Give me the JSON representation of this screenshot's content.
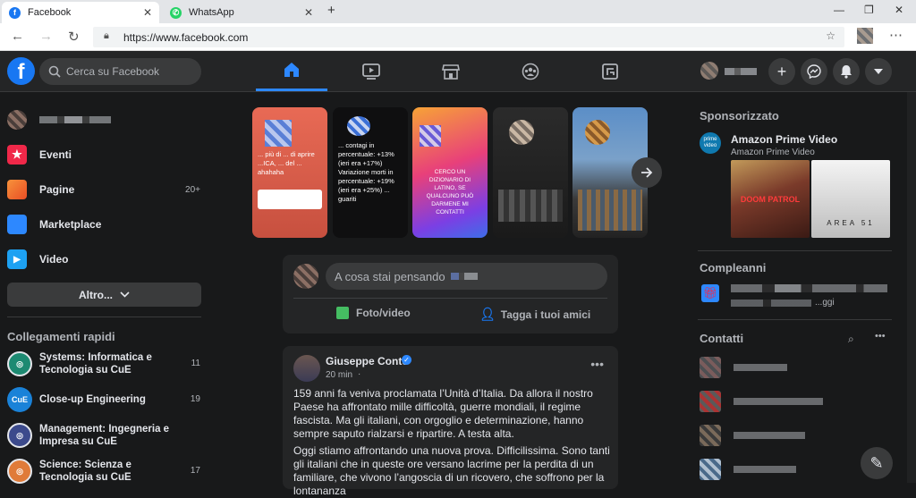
{
  "browser": {
    "tabs": [
      {
        "title": "Facebook",
        "active": true
      },
      {
        "title": "WhatsApp",
        "active": false
      }
    ],
    "url": "https://www.facebook.com"
  },
  "header": {
    "search_placeholder": "Cerca su Facebook",
    "accent": "#2d88ff"
  },
  "left_nav": {
    "items": [
      {
        "label": "Eventi",
        "badge": ""
      },
      {
        "label": "Pagine",
        "badge": "20+"
      },
      {
        "label": "Marketplace",
        "badge": ""
      },
      {
        "label": "Video",
        "badge": ""
      }
    ],
    "more_label": "Altro...",
    "shortcuts_title": "Collegamenti rapidi",
    "shortcuts": [
      {
        "label": "Systems: Informatica e Tecnologia su CuE",
        "badge": "11"
      },
      {
        "label": "Close-up Engineering",
        "badge": "19"
      },
      {
        "label": "Management: Ingegneria e Impresa su CuE",
        "badge": ""
      },
      {
        "label": "Science: Scienza e Tecnologia su CuE",
        "badge": "17"
      }
    ]
  },
  "stories": [
    {
      "text": "... più di ... di aprire ...ICA, ... del ... ahahaha"
    },
    {
      "text": "... contagi in percentuale: +13% (ieri era +17%) Variazione morti in percentuale: +19% (ieri era +25%) ... guariti"
    },
    {
      "text": "CERCO UN DIZIONARIO DI LATINO, SE QUALCUNO PUÒ DARMENE MI CONTATTI"
    },
    {
      "text": ""
    },
    {
      "text": ""
    }
  ],
  "composer": {
    "placeholder": "A cosa stai pensando",
    "photo_label": "Foto/video",
    "tag_label": "Tagga i tuoi amici"
  },
  "post": {
    "author": "Giuseppe Conte",
    "time": "20 min",
    "text1": "159 anni fa veniva proclamata l’Unità d’Italia. Da allora il nostro Paese ha affrontato mille difficoltà, guerre mondiali, il regime fascista. Ma gli italiani, con orgoglio e determinazione, hanno sempre saputo rialzarsi e ripartire. A testa alta.",
    "text2": "Oggi stiamo affrontando una nuova prova. Difficilissima. Sono tanti gli italiani che in queste ore versano lacrime per la perdita di un familiare, che vivono l’angoscia di un ricovero, che soffrono per la lontananza"
  },
  "right": {
    "sponsored_title": "Sponsorizzato",
    "ad_name": "Amazon Prime Video",
    "ad_sub": "Amazon Prime Video",
    "ad_logo": "prime video",
    "poster1_title": "DOOM PATROL",
    "poster2_title": "AREA 51",
    "birthdays_title": "Compleanni",
    "birthday_sub": "...ggi",
    "contacts_title": "Contatti"
  }
}
